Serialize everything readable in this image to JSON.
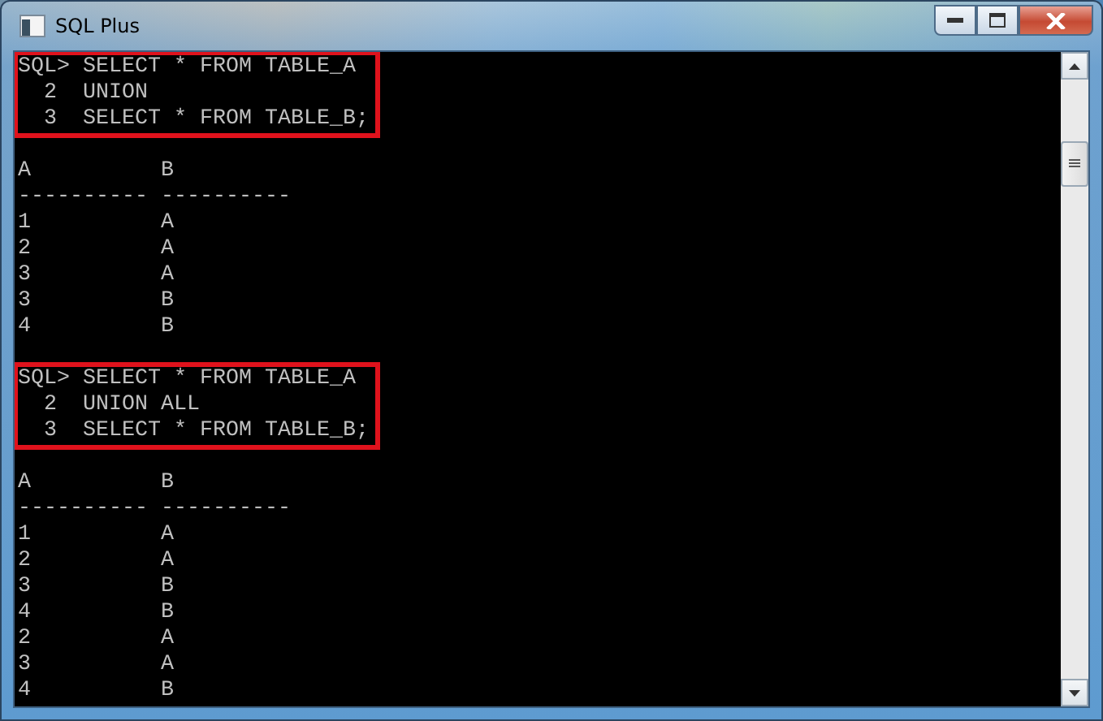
{
  "window": {
    "title": "SQL Plus"
  },
  "console": {
    "blocks": [
      {
        "kind": "query",
        "highlighted": true,
        "lines": [
          "SQL> SELECT * FROM TABLE_A",
          "  2  UNION",
          "  3  SELECT * FROM TABLE_B;"
        ]
      },
      {
        "kind": "result",
        "columns": [
          {
            "heading": "A",
            "rule": "----------"
          },
          {
            "heading": "B",
            "rule": "----------"
          }
        ],
        "rows": [
          [
            "1",
            "A"
          ],
          [
            "2",
            "A"
          ],
          [
            "3",
            "A"
          ],
          [
            "3",
            "B"
          ],
          [
            "4",
            "B"
          ]
        ]
      },
      {
        "kind": "query",
        "highlighted": true,
        "lines": [
          "SQL> SELECT * FROM TABLE_A",
          "  2  UNION ALL",
          "  3  SELECT * FROM TABLE_B;"
        ]
      },
      {
        "kind": "result",
        "columns": [
          {
            "heading": "A",
            "rule": "----------"
          },
          {
            "heading": "B",
            "rule": "----------"
          }
        ],
        "rows": [
          [
            "1",
            "A"
          ],
          [
            "2",
            "A"
          ],
          [
            "3",
            "B"
          ],
          [
            "4",
            "B"
          ],
          [
            "2",
            "A"
          ],
          [
            "3",
            "A"
          ],
          [
            "4",
            "B"
          ]
        ]
      }
    ]
  }
}
